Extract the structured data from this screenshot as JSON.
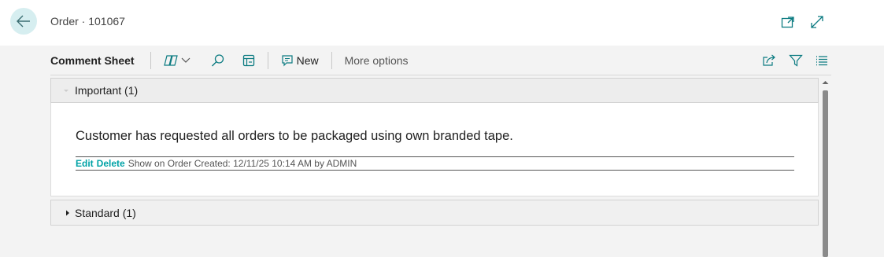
{
  "header": {
    "title": "Order · 101067",
    "back_icon": "arrow-left-icon",
    "popout_icon": "open-in-new-window-icon",
    "expand_icon": "expand-icon"
  },
  "toolbar": {
    "title": "Comment Sheet",
    "copilot_icon": "copilot-icon",
    "search_icon": "search-icon",
    "edit_list_icon": "edit-list-icon",
    "new_label": "New",
    "new_icon": "comment-icon",
    "more_label": "More options",
    "share_icon": "share-icon",
    "filter_icon": "filter-icon",
    "list_icon": "list-view-icon"
  },
  "sections": {
    "important": {
      "title": "Important (1)",
      "expanded": true,
      "comment": {
        "text": "Customer has requested all orders to be packaged using own branded tape.",
        "edit_label": "Edit",
        "delete_label": "Delete",
        "info": "Show on Order Created: 12/11/25 10:14 AM by ADMIN"
      }
    },
    "standard": {
      "title": "Standard (1)",
      "expanded": false
    }
  },
  "colors": {
    "accent": "#00a2a6",
    "back_button_bg": "#d6eef0",
    "page_bg": "#f3f3f3"
  }
}
